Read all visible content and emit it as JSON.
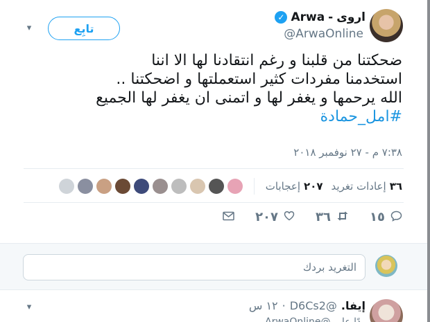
{
  "tweet": {
    "author_name_ar": "اروى",
    "author_sep": "-",
    "author_name_en": "Arwa",
    "verified_mark": "✓",
    "handle": "@ArwaOnline",
    "follow_label": "تابِع",
    "text_lines": [
      "ضحكتنا من قلبنا و رغم انتقادنا لها الا اننا",
      "استخدمنا مفردات كثير استعملتها و اضحكتنا  ..",
      "الله يرحمها و يغفر لها و اتمنى ان يغفر لها الجميع"
    ],
    "hashtag": "#امل_حمادة",
    "timestamp": "٧:٣٨ م - ٢٧ نوفمبر ٢٠١٨",
    "retweets_count": "٣٦",
    "retweets_label": "إعادات تغريد",
    "likes_count": "٢٠٧",
    "likes_label": "إعجابات",
    "liker_colors": [
      "#e7a3b5",
      "#555555",
      "#d9c6b0",
      "#bdbdbd",
      "#9a8f8f",
      "#3d4a7a",
      "#6b4a35",
      "#c9a083",
      "#8a8fa0",
      "#cfd4d9"
    ],
    "actions": {
      "reply_count": "١٥",
      "retweet_count": "٣٦",
      "like_count": "٢٠٧"
    }
  },
  "composer": {
    "placeholder": "التغريد بردك"
  },
  "reply": {
    "name": "إيفا.",
    "handle": "@D6Cs2",
    "dot": "·",
    "time": "١٢ س",
    "cut_text": "ردًا على @ArwaOnline"
  },
  "colors": {
    "accent": "#1da1f2",
    "hashtag": "#1b95e0",
    "muted": "#657786"
  }
}
